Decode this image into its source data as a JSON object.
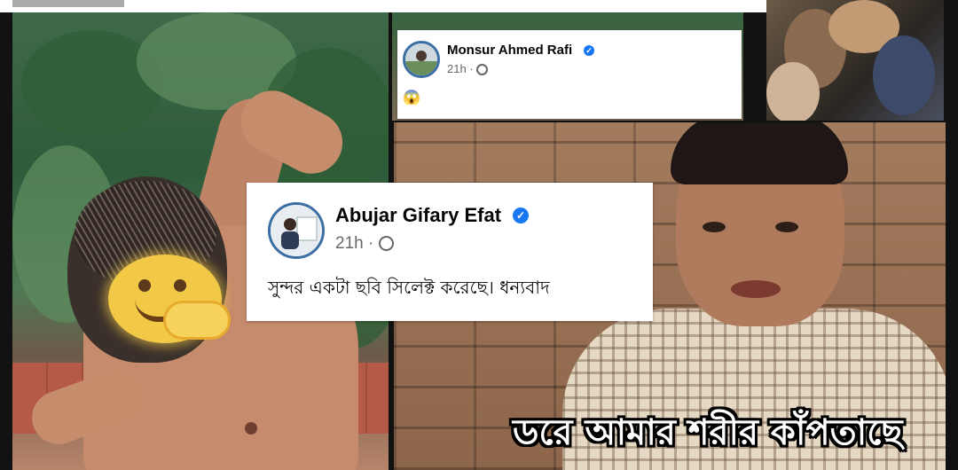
{
  "comments": [
    {
      "author": "Monsur Ahmed Rafi",
      "time": "21h ·",
      "text": "😱",
      "verified_icon": "verified-badge-icon",
      "audience_icon": "globe-icon"
    },
    {
      "author": "Abujar Gifary Efat",
      "time": "21h ·",
      "text": "সুন্দর একটা ছবি সিলেক্ট করেছে। ধন্যবাদ",
      "verified_icon": "verified-badge-icon",
      "audience_icon": "globe-icon"
    }
  ],
  "meme_caption": "ডরে আমার শরীর কাঁপতাছে",
  "colors": {
    "verified_blue": "#1877f2",
    "meta_gray": "#65676b",
    "emoji_yellow": "#f2c847"
  }
}
